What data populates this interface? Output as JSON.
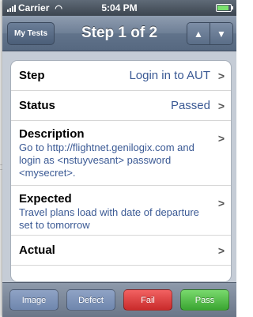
{
  "status_bar": {
    "carrier": "Carrier",
    "time": "5:04 PM",
    "icons": [
      "signal-icon",
      "wifi-icon",
      "battery-icon"
    ]
  },
  "nav": {
    "back_label": "My Tests",
    "title": "Step 1 of 2",
    "prev_icon": "up-arrow-icon",
    "next_icon": "down-arrow-icon"
  },
  "rows": [
    {
      "label": "Step",
      "value": "Login in to AUT"
    },
    {
      "label": "Status",
      "value": "Passed"
    },
    {
      "label": "Description",
      "value": "Go to http://flightnet.genilogix.com and login as <nstuyvesant> password <mysecret>."
    },
    {
      "label": "Expected",
      "value": "Travel plans load with date of departure set to tomorrow"
    },
    {
      "label": "Actual",
      "value": ""
    }
  ],
  "toolbar": {
    "image_label": "Image",
    "defect_label": "Defect",
    "fail_label": "Fail",
    "pass_label": "Pass"
  },
  "colors": {
    "value_text": "#3a5994",
    "fail": "#d83a3a",
    "pass": "#4bb840",
    "nav_bar": "#6e7f96"
  }
}
